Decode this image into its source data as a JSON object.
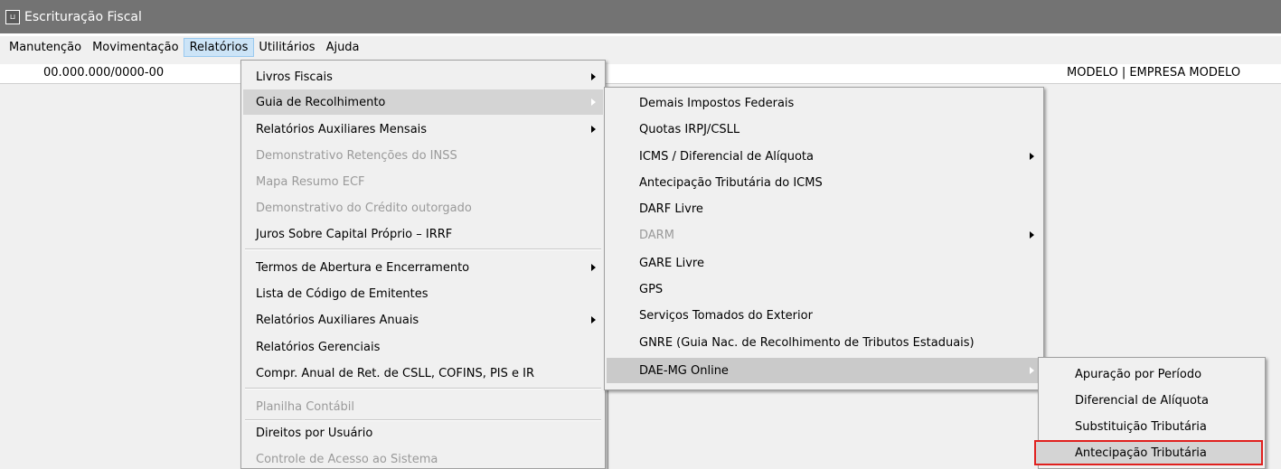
{
  "window": {
    "icon": "app-icon",
    "title": "Escrituração Fiscal"
  },
  "menubar": [
    "Manutenção",
    "Movimentação",
    "Relatórios",
    "Utilitários",
    "Ajuda"
  ],
  "status": {
    "cnpj": "00.000.000/0000-00",
    "empresa": "MODELO | EMPRESA MODELO"
  },
  "relatorios_menu": [
    "Livros Fiscais",
    "Guia de Recolhimento",
    "Relatórios Auxiliares Mensais",
    "Demonstrativo Retenções do INSS",
    "Mapa Resumo ECF",
    "Demonstrativo do Crédito outorgado",
    "Juros Sobre Capital Próprio – IRRF",
    "Termos de Abertura e Encerramento",
    "Lista de Código de Emitentes",
    "Relatórios Auxiliares Anuais",
    "Relatórios Gerenciais",
    "Compr. Anual de Ret. de CSLL, COFINS,  PIS e IR",
    "Planilha Contábil",
    "Direitos por Usuário",
    "Controle de Acesso ao Sistema"
  ],
  "guia_menu": [
    "Demais Impostos Federais",
    "Quotas IRPJ/CSLL",
    "ICMS / Diferencial de Alíquota",
    "Antecipação Tributária do ICMS",
    "DARF Livre",
    "DARM",
    "GARE Livre",
    "GPS",
    "Serviços Tomados do Exterior",
    "GNRE (Guia Nac. de Recolhimento de Tributos Estaduais)",
    "DAE-MG Online"
  ],
  "dae_menu": [
    "Apuração por Período",
    "Diferencial de Alíquota",
    "Substituição Tributária",
    "Antecipação Tributária"
  ],
  "colors": {
    "titlebar": "#737373",
    "highlight": "#d4d4d4",
    "selection_box": "#e0201e"
  }
}
